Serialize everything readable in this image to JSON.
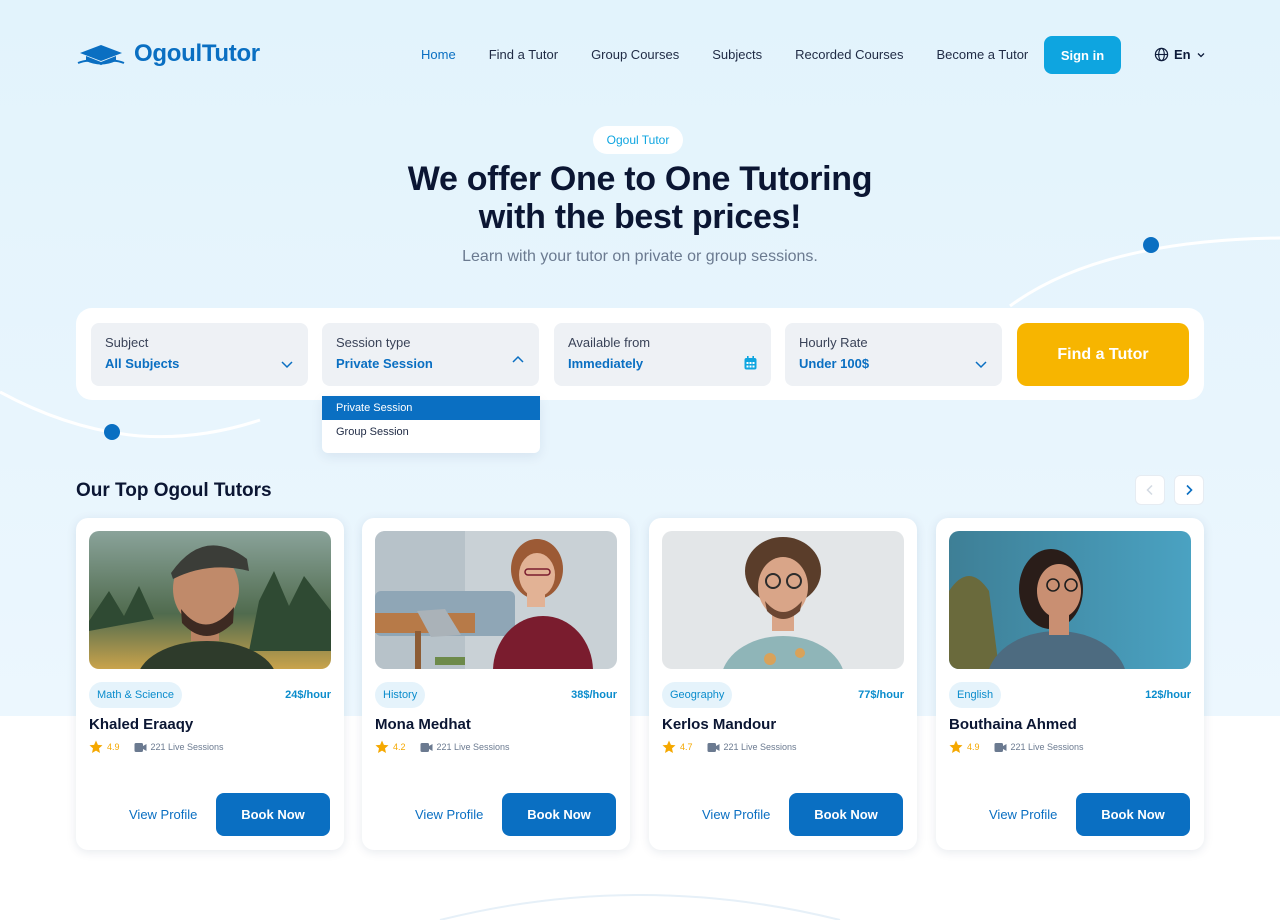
{
  "brand": {
    "name": "OgoulTutor",
    "logo_icon": "graduation-cap-book-icon",
    "color": "#0a6fc2"
  },
  "nav": {
    "items": [
      {
        "label": "Home",
        "active": true
      },
      {
        "label": "Find a Tutor"
      },
      {
        "label": "Group Courses"
      },
      {
        "label": "Subjects"
      },
      {
        "label": "Recorded Courses"
      },
      {
        "label": "Become a Tutor"
      }
    ],
    "signin_label": "Sign in",
    "language": "En"
  },
  "hero": {
    "tag": "Ogoul Tutor",
    "title_line1": "We offer One to One Tutoring",
    "title_line2": "with the best prices!",
    "subtitle": "Learn with your tutor on private or group sessions."
  },
  "search": {
    "fields": [
      {
        "label": "Subject",
        "value": "All Subjects",
        "icon": "chevron-down-icon"
      },
      {
        "label": "Session type",
        "value": "Private Session",
        "icon": "chevron-up-icon"
      },
      {
        "label": "Available from",
        "value": "Immediately",
        "icon": "calendar-icon"
      },
      {
        "label": "Hourly Rate",
        "value": "Under 100$",
        "icon": "chevron-down-icon"
      }
    ],
    "find_label": "Find a Tutor",
    "session_options": [
      "Private Session",
      "Group Session"
    ],
    "selected_option": "Private Session"
  },
  "tutors_section": {
    "title": "Our Top Ogoul Tutors",
    "tutors": [
      {
        "name": "Khaled Eraaqy",
        "subject": "Math & Science",
        "price": "24$/hour",
        "rating": "4.9",
        "sessions": "221 Live Sessions"
      },
      {
        "name": "Mona Medhat",
        "subject": "History",
        "price": "38$/hour",
        "rating": "4.2",
        "sessions": "221 Live Sessions"
      },
      {
        "name": "Kerlos Mandour",
        "subject": "Geography",
        "price": "77$/hour",
        "rating": "4.7",
        "sessions": "221 Live Sessions"
      },
      {
        "name": "Bouthaina Ahmed",
        "subject": "English",
        "price": "12$/hour",
        "rating": "4.9",
        "sessions": "221 Live Sessions"
      }
    ],
    "view_profile_label": "View Profile",
    "book_label": "Book Now"
  },
  "colors": {
    "primary": "#0a6fc2",
    "accent": "#0ea5e0",
    "cta": "#f7b500",
    "star": "#f5a800"
  }
}
